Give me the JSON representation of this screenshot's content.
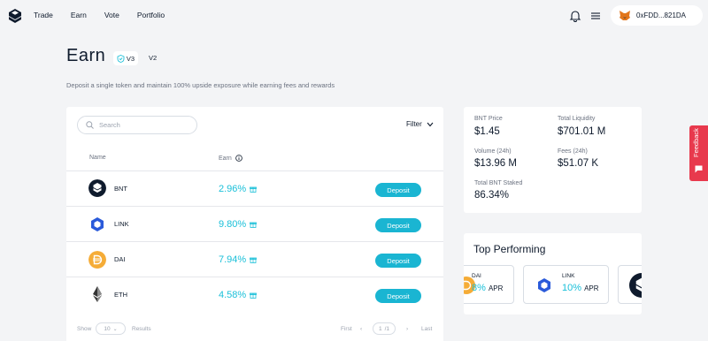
{
  "nav": {
    "items": [
      "Trade",
      "Earn",
      "Vote",
      "Portfolio"
    ]
  },
  "wallet": {
    "address": "0xFDD...821DA"
  },
  "page": {
    "title": "Earn",
    "version_active": "V3",
    "version_other": "V2",
    "subtitle": "Deposit a single token and maintain 100% upside exposure while earning fees and rewards"
  },
  "search": {
    "placeholder": "Search"
  },
  "filter_label": "Filter",
  "table": {
    "headers": {
      "name": "Name",
      "earn": "Earn"
    },
    "deposit_label": "Deposit",
    "rows": [
      {
        "symbol": "BNT",
        "apr": "2.96%"
      },
      {
        "symbol": "LINK",
        "apr": "9.80%"
      },
      {
        "symbol": "DAI",
        "apr": "7.94%"
      },
      {
        "symbol": "ETH",
        "apr": "4.58%"
      }
    ]
  },
  "pagination": {
    "show": "Show",
    "page_size": "10",
    "results": "Results",
    "first": "First",
    "page": "1",
    "of": "/1",
    "last": "Last"
  },
  "stats": {
    "bnt_price_label": "BNT Price",
    "bnt_price": "$1.45",
    "total_liquidity_label": "Total Liquidity",
    "total_liquidity": "$701.01 M",
    "volume_label": "Volume (24h)",
    "volume": "$13.96 M",
    "fees_label": "Fees (24h)",
    "fees": "$51.07 K",
    "staked_label": "Total BNT Staked",
    "staked": "86.34%"
  },
  "top_performing": {
    "title": "Top Performing",
    "apr_label": "APR",
    "items": [
      {
        "symbol": "DAI",
        "apr": "8%"
      },
      {
        "symbol": "LINK",
        "apr": "10%"
      }
    ]
  },
  "feedback_label": "Feedback",
  "colors": {
    "accent": "#1bc0d9",
    "button": "#1ab5d2",
    "feedback": "#e8394d",
    "dai": "#f5ac37",
    "link": "#2a5ada"
  }
}
